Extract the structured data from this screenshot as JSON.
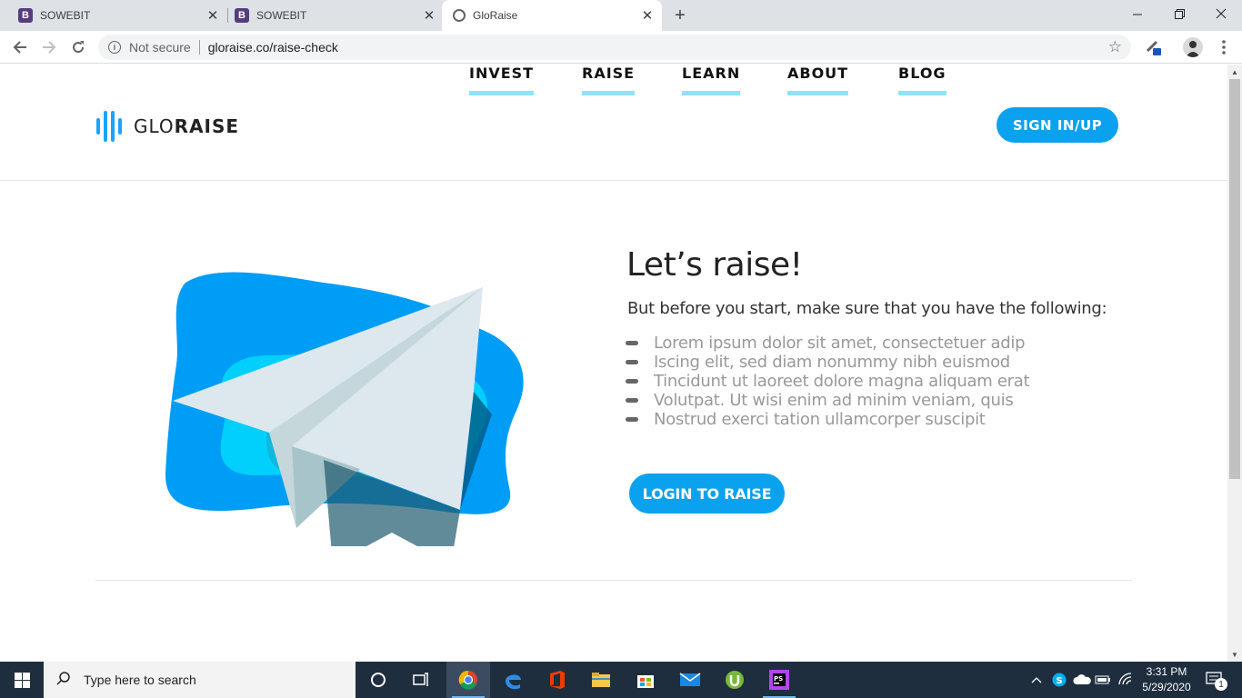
{
  "browser": {
    "tabs": [
      {
        "title": "SOWEBIT",
        "favicon": "B",
        "active": false
      },
      {
        "title": "SOWEBIT",
        "favicon": "B",
        "active": false
      },
      {
        "title": "GloRaise",
        "favicon": "globe-icon",
        "active": true
      }
    ],
    "close_glyph": "✕",
    "new_tab_glyph": "+",
    "security_label": "Not secure",
    "url": "gloraise.co/raise-check"
  },
  "site": {
    "logo": {
      "light": "GLO",
      "bold": "RAISE"
    },
    "nav": [
      "INVEST",
      "RAISE",
      "LEARN",
      "ABOUT",
      "BLOG"
    ],
    "signin_label": "SIGN IN/UP",
    "accent_color": "#0aa2ee",
    "underline_color": "#8ee4f7"
  },
  "hero": {
    "headline": "Let’s raise!",
    "intro": "But before you start, make sure that you have the following:",
    "requirements": [
      "Lorem ipsum dolor sit amet, consectetuer adip",
      "Iscing elit, sed diam nonummy nibh euismod",
      "Tincidunt ut laoreet dolore magna aliquam erat",
      "Volutpat. Ut wisi enim ad minim veniam, quis",
      "Nostrud exerci tation ullamcorper suscipit"
    ],
    "cta_label": "LOGIN TO RAISE"
  },
  "taskbar": {
    "search_placeholder": "Type here to search",
    "time": "3:31 PM",
    "date": "5/29/2020",
    "notification_count": "1",
    "apps": [
      "cortana-icon",
      "task-view-icon",
      "chrome-icon",
      "edge-icon",
      "office-icon",
      "file-explorer-icon",
      "store-icon",
      "mail-icon",
      "utorrent-icon",
      "phpstorm-icon"
    ]
  }
}
